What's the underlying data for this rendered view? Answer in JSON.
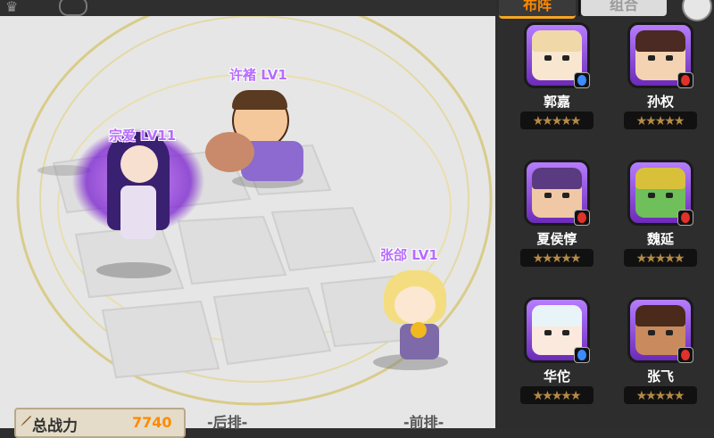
{
  "tabs": {
    "active_label": "布阵",
    "inactive_label": "组合"
  },
  "battlefield": {
    "units": [
      {
        "name": "许褚 LV1",
        "key": "xuchu"
      },
      {
        "name": "宗爱 LV11",
        "key": "zongai"
      },
      {
        "name": "张郃 LV1",
        "key": "zhanghe"
      }
    ]
  },
  "bottom_bar": {
    "power_label": "总战力",
    "power_value": "7740",
    "back_row_label": "-后排-",
    "front_row_label": "-前排-"
  },
  "roster": [
    {
      "name": "郭嘉",
      "badge": "blue",
      "stars": 5
    },
    {
      "name": "孙权",
      "badge": "red",
      "stars": 5
    },
    {
      "name": "夏侯惇",
      "badge": "red",
      "stars": 5
    },
    {
      "name": "魏延",
      "badge": "red",
      "stars": 5
    },
    {
      "name": "华佗",
      "badge": "blue",
      "stars": 5
    },
    {
      "name": "张飞",
      "badge": "red",
      "stars": 5
    }
  ],
  "colors": {
    "accent": "#ff8a00",
    "unit_name": "#b66cff",
    "badge_blue": "#3a8cff",
    "badge_red": "#e0322a"
  }
}
